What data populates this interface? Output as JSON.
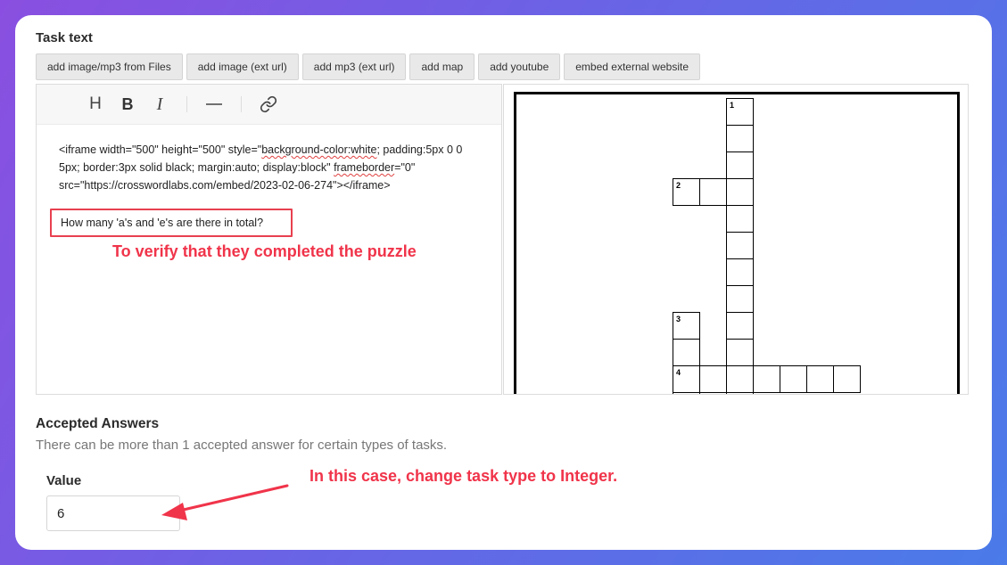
{
  "task_text": {
    "title": "Task text",
    "buttons": [
      "add image/mp3 from Files",
      "add image (ext url)",
      "add mp3 (ext url)",
      "add map",
      "add youtube",
      "embed external website"
    ]
  },
  "editor": {
    "toolbar": {
      "heading": "H",
      "bold": "B",
      "italic": "I",
      "hr": "—"
    },
    "code": {
      "p1": "<iframe width=\"500\" height=\"500\" style=\"",
      "w1": "background-color:white",
      "p2": "; padding:5px 0 0 5px; border:3px solid black; margin:auto; display:block\" ",
      "w2": "frameborder",
      "p3": "=\"0\" src=\"https://crosswordlabs.com/embed/2023-02-06-274\"></iframe>"
    },
    "question": "How many 'a's and 'e's are there in total?"
  },
  "annotations": {
    "verify": "To verify that they completed the puzzle",
    "change_type": "In this case, change task type to Integer."
  },
  "crossword": {
    "numbers": [
      "1",
      "2",
      "3",
      "4"
    ]
  },
  "accepted_answers": {
    "title": "Accepted Answers",
    "description": "There can be more than 1 accepted answer for certain types of tasks.",
    "value_label": "Value",
    "value": "6"
  },
  "colors": {
    "annotation": "#f0344a",
    "background_start": "#8a4fe0",
    "background_end": "#4a7be8"
  }
}
